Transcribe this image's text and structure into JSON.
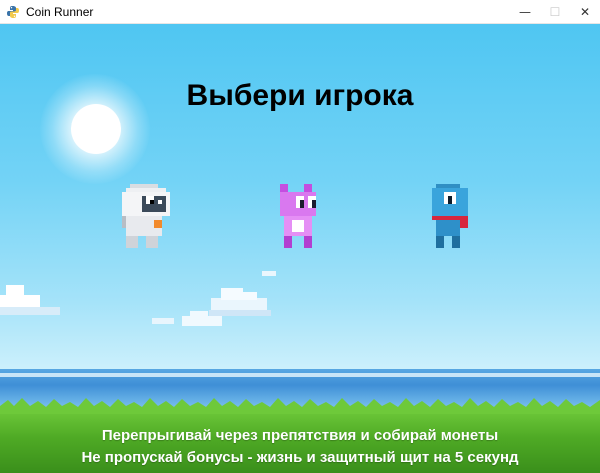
{
  "window": {
    "title": "Coin Runner",
    "icon": "python-icon",
    "controls": {
      "minimize": "—",
      "maximize": "☐",
      "close": "✕"
    }
  },
  "game": {
    "heading": "Выбери игрока",
    "characters": [
      {
        "id": "astronaut",
        "icon": "astronaut-character-icon"
      },
      {
        "id": "pink-cat",
        "icon": "pink-cat-character-icon"
      },
      {
        "id": "blue-creature",
        "icon": "blue-creature-character-icon"
      }
    ],
    "hints": [
      "Перепрыгивай через препятствия и собирай монеты",
      "Не пропускай бонусы - жизнь и защитный щит на 5 секунд"
    ],
    "colors": {
      "sky_top": "#4fc6f2",
      "sky_bottom": "#e8f8fe",
      "sea": "#3f8fd6",
      "grass": "#4faa25",
      "hint_text": "#ffffff",
      "heading_text": "#000000"
    }
  }
}
